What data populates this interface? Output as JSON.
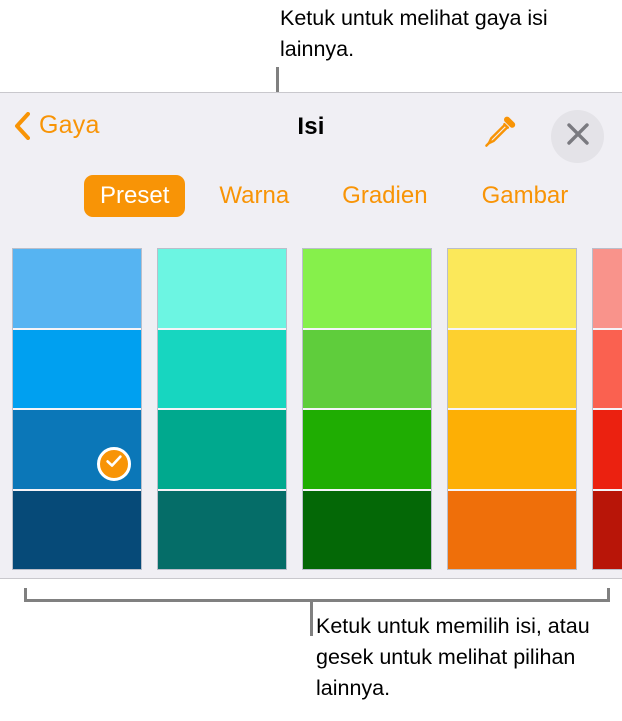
{
  "callouts": {
    "top": "Ketuk untuk melihat gaya isi lainnya.",
    "bottom": "Ketuk untuk memilih isi, atau gesek untuk melihat pilihan lainnya."
  },
  "panel": {
    "title": "Isi",
    "back_label": "Gaya",
    "back_icon": "chevron-left-icon",
    "eyedropper_icon": "eyedropper-icon",
    "close_icon": "close-icon",
    "accent_color": "#f89406",
    "background_color": "#f0eff4"
  },
  "tabs": [
    {
      "label": "Preset",
      "active": true
    },
    {
      "label": "Warna",
      "active": false
    },
    {
      "label": "Gradien",
      "active": false
    },
    {
      "label": "Gambar",
      "active": false
    }
  ],
  "swatches": {
    "selected_column": 0,
    "selected_row": 2,
    "check_icon": "checkmark-icon",
    "columns": [
      {
        "name": "blue",
        "colors": [
          "#56b4f2",
          "#00a0f0",
          "#0b77b8",
          "#064a78"
        ]
      },
      {
        "name": "teal",
        "colors": [
          "#6cf5e2",
          "#17d6c0",
          "#00a98e",
          "#056d68"
        ]
      },
      {
        "name": "green",
        "colors": [
          "#86f04b",
          "#5fcd3c",
          "#1fad02",
          "#046806"
        ]
      },
      {
        "name": "yellow-orange",
        "colors": [
          "#fbe85a",
          "#fdd02f",
          "#fdaf05",
          "#ef6f0a"
        ]
      },
      {
        "name": "red",
        "colors": [
          "#f9938b",
          "#fa6150",
          "#eb2110",
          "#b81508"
        ]
      }
    ]
  }
}
